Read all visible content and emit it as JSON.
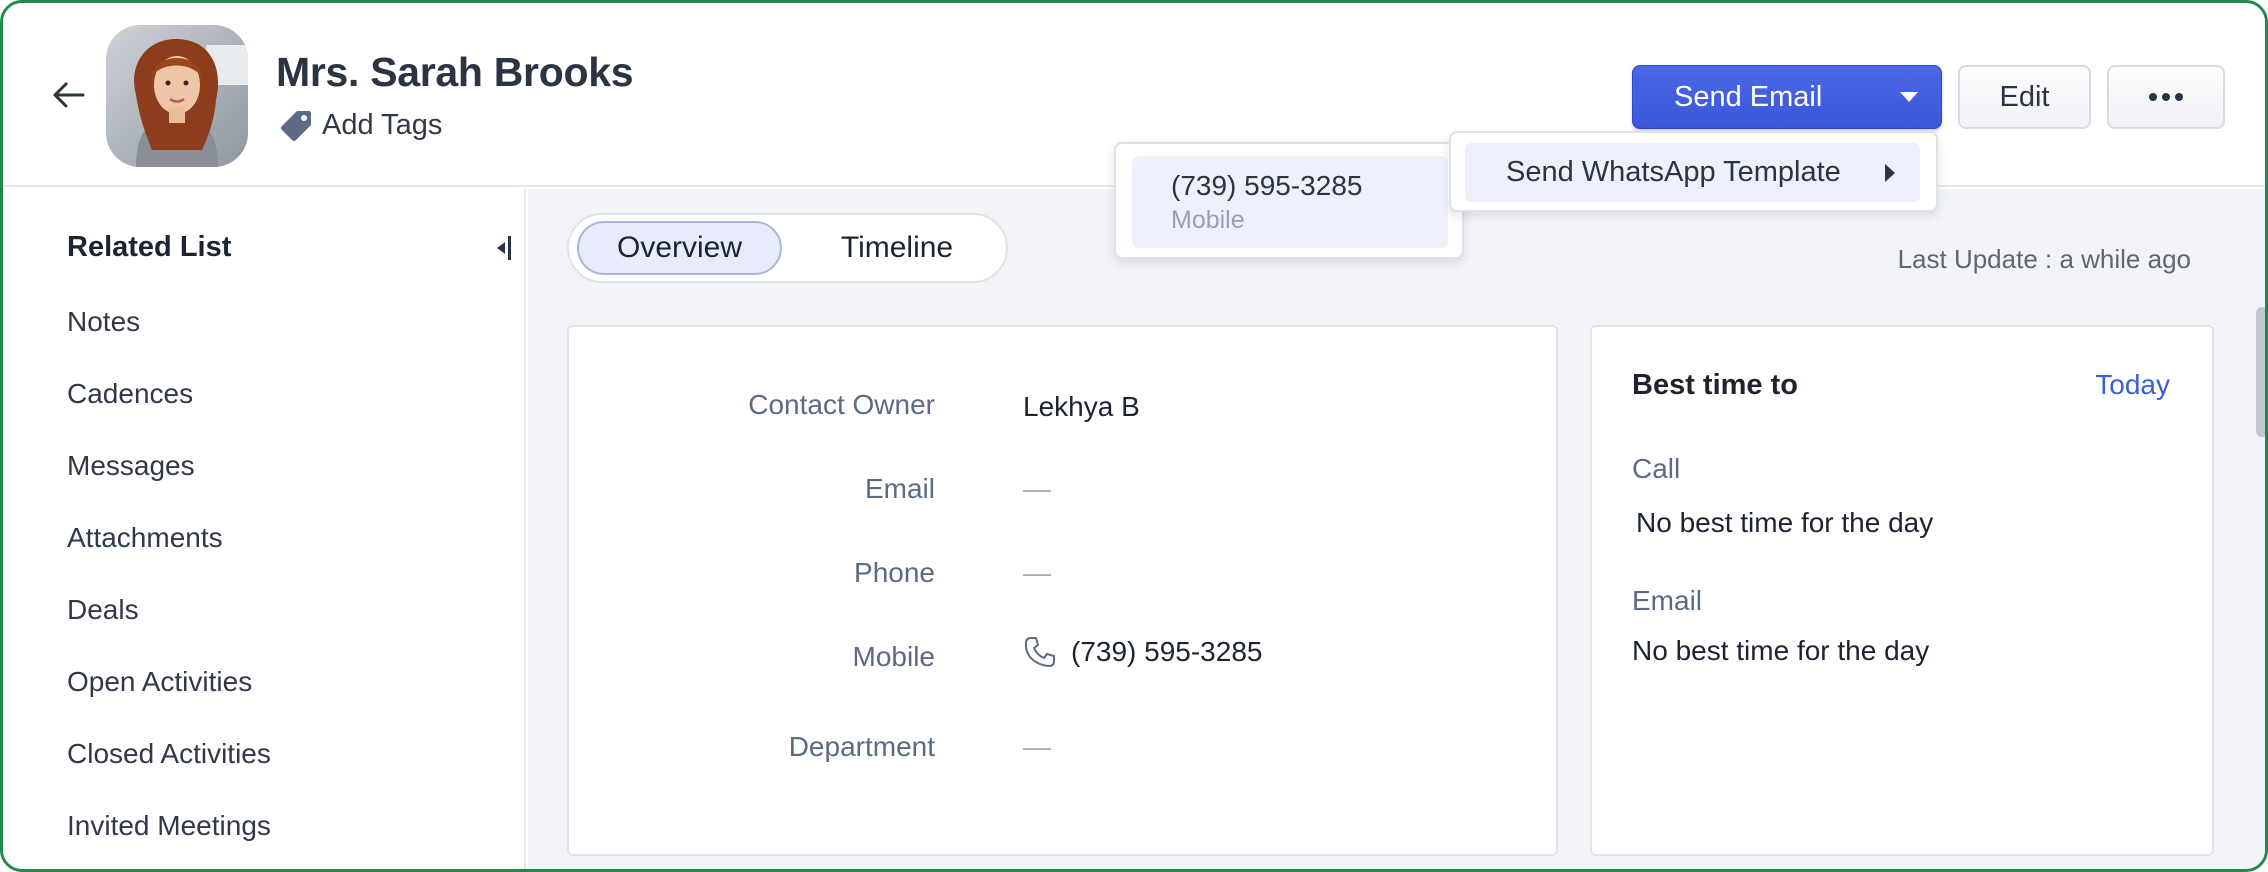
{
  "header": {
    "contact_name": "Mrs. Sarah Brooks",
    "add_tags_label": "Add Tags",
    "send_email_label": "Send Email",
    "edit_label": "Edit"
  },
  "sidebar": {
    "title": "Related List",
    "items": [
      {
        "label": "Notes"
      },
      {
        "label": "Cadences"
      },
      {
        "label": "Messages"
      },
      {
        "label": "Attachments"
      },
      {
        "label": "Deals"
      },
      {
        "label": "Open Activities"
      },
      {
        "label": "Closed Activities"
      },
      {
        "label": "Invited Meetings"
      }
    ]
  },
  "tabs": [
    {
      "label": "Overview",
      "active": true
    },
    {
      "label": "Timeline",
      "active": false
    }
  ],
  "last_update": "Last Update : a while ago",
  "fields": [
    {
      "label": "Contact Owner",
      "value": "Lekhya B"
    },
    {
      "label": "Email",
      "value": "—"
    },
    {
      "label": "Phone",
      "value": "—"
    },
    {
      "label": "Mobile",
      "value": "(739) 595-3285"
    },
    {
      "label": "Department",
      "value": "—"
    }
  ],
  "best_time": {
    "title": "Best time to",
    "period": "Today",
    "call_label": "Call",
    "call_text": "No best time for the day",
    "email_label": "Email",
    "email_text": "No best time for the day"
  },
  "phone_popup": {
    "number": "(739) 595-3285",
    "type": "Mobile"
  },
  "send_menu": {
    "item_label": "Send WhatsApp Template"
  },
  "colors": {
    "accent": "#3a56d9",
    "frame_border": "#1f8a4c",
    "link": "#3a5de0"
  },
  "icons": {
    "back": "arrow-left-icon",
    "tag": "tag-icon",
    "caret": "caret-down-icon",
    "more": "more-horizontal-icon",
    "collapse": "collapse-sidebar-icon",
    "phone": "phone-icon",
    "submenu": "caret-right-icon"
  }
}
